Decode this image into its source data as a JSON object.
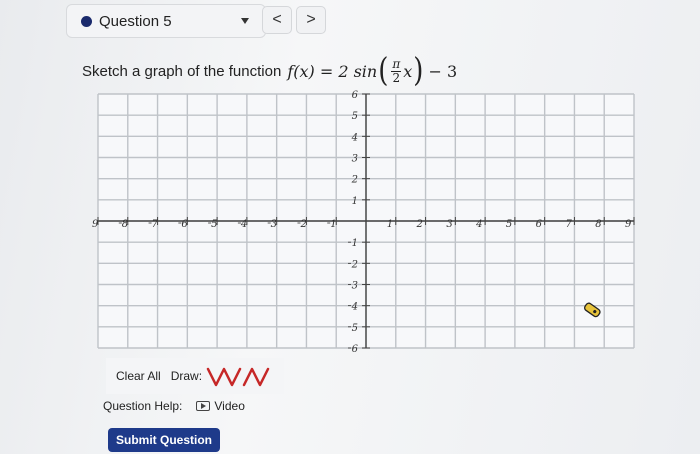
{
  "question_selector": {
    "label": "Question 5",
    "dot_color": "#1a2a6c"
  },
  "nav": {
    "prev_label": "<",
    "next_label": ">"
  },
  "prompt": {
    "text": "Sketch a graph of the function",
    "formula_lhs": "f(x) = 2 sin",
    "formula_num": "π",
    "formula_den": "2",
    "formula_var": "x",
    "formula_tail": "− 3"
  },
  "graph": {
    "x_range": [
      -9,
      9
    ],
    "y_range": [
      -6,
      6
    ],
    "x_tick_labels": [
      "9",
      "8",
      "7",
      "6",
      "5",
      "4",
      "3",
      "2",
      "1",
      "1",
      "2",
      "3",
      "4",
      "5",
      "6",
      "7",
      "8",
      "9"
    ],
    "x_ticks": [
      -9,
      -8,
      -7,
      -6,
      -5,
      -4,
      -3,
      -2,
      -1,
      1,
      2,
      3,
      4,
      5,
      6,
      7,
      8,
      9
    ],
    "y_tick_labels": [
      "6",
      "5",
      "4",
      "3",
      "2",
      "1",
      "1",
      "2",
      "3",
      "4",
      "5",
      "6"
    ],
    "y_ticks": [
      6,
      5,
      4,
      3,
      2,
      1,
      -1,
      -2,
      -3,
      -4,
      -5,
      -6
    ],
    "grid": true,
    "axis_color": "#444444",
    "grid_color": "#bfc3c8"
  },
  "tools": {
    "clear_label": "Clear All",
    "draw_label": "Draw:",
    "wave_icon": "sine-wave-icon",
    "wave_color": "#c62828"
  },
  "help": {
    "label": "Question Help:",
    "video_label": "Video",
    "video_icon": "play-icon"
  },
  "submit_label": "Submit Question",
  "accent_color": "#1e3a8a"
}
